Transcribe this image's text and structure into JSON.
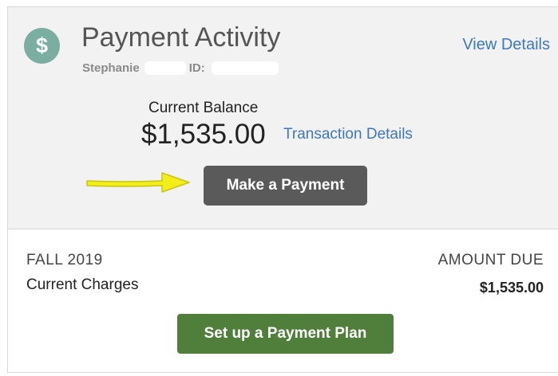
{
  "header": {
    "icon": "dollar-icon",
    "icon_glyph": "$",
    "icon_color": "#7aaea0",
    "title": "Payment Activity",
    "user_name": "Stephanie",
    "id_label": "ID:",
    "view_details_label": "View Details"
  },
  "balance": {
    "label": "Current Balance",
    "amount": "$1,535.00",
    "transaction_details_label": "Transaction Details",
    "make_payment_label": "Make a Payment"
  },
  "charges": {
    "term": "FALL 2019",
    "label": "Current Charges",
    "amount_due_header": "AMOUNT DUE",
    "amount_due_value": "$1,535.00",
    "payment_plan_label": "Set up a Payment Plan"
  },
  "colors": {
    "link": "#3d78c6",
    "make_payment_bg": "#5a5a5a",
    "payment_plan_bg": "#4f7f3a",
    "arrow": "#f2ee1a"
  }
}
